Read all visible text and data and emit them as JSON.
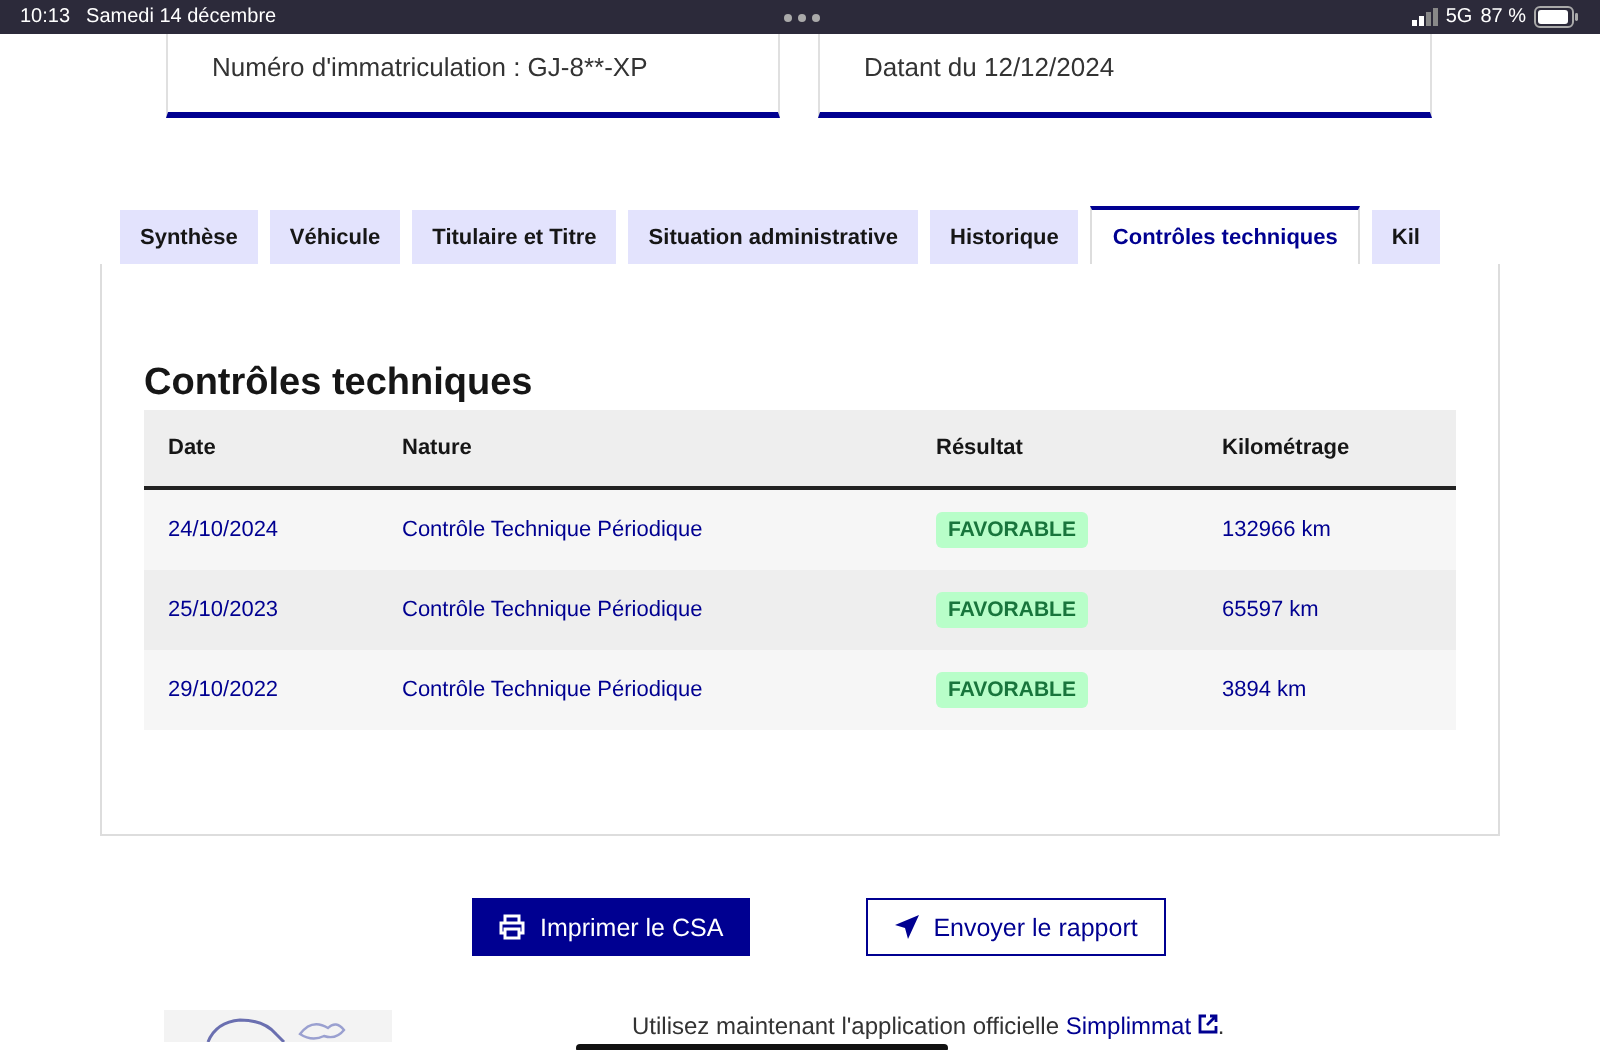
{
  "status_bar": {
    "time": "10:13",
    "date": "Samedi 14 décembre",
    "network": "5G",
    "battery": "87 %"
  },
  "info_cards": [
    "Numéro d'immatriculation : GJ-8**-XP",
    "Datant du 12/12/2024"
  ],
  "tabs": [
    {
      "label": "Synthèse",
      "selected": false
    },
    {
      "label": "Véhicule",
      "selected": false
    },
    {
      "label": "Titulaire et Titre",
      "selected": false
    },
    {
      "label": "Situation administrative",
      "selected": false
    },
    {
      "label": "Historique",
      "selected": false
    },
    {
      "label": "Contrôles techniques",
      "selected": true
    },
    {
      "label": "Kil",
      "selected": false
    }
  ],
  "section_title": "Contrôles techniques",
  "table": {
    "columns": [
      "Date",
      "Nature",
      "Résultat",
      "Kilométrage"
    ],
    "rows": [
      {
        "date": "24/10/2024",
        "nature": "Contrôle Technique Périodique",
        "result": "FAVORABLE",
        "mileage": "132966 km"
      },
      {
        "date": "25/10/2023",
        "nature": "Contrôle Technique Périodique",
        "result": "FAVORABLE",
        "mileage": "65597 km"
      },
      {
        "date": "29/10/2022",
        "nature": "Contrôle Technique Périodique",
        "result": "FAVORABLE",
        "mileage": "3894 km"
      }
    ]
  },
  "buttons": [
    {
      "label": "Imprimer le CSA",
      "kind": "primary"
    },
    {
      "label": "Envoyer le rapport",
      "kind": "secondary"
    }
  ],
  "promo": {
    "text": "Utilisez maintenant l'application officielle",
    "link": "Simplimmat",
    "after": "."
  }
}
